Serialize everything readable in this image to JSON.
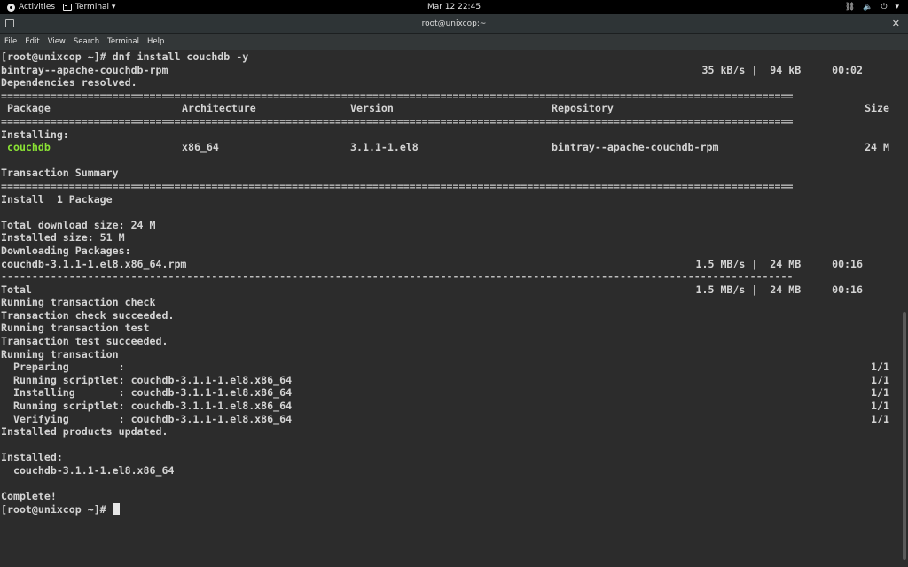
{
  "topbar": {
    "activities": "Activities",
    "app_menu": "Terminal ▾",
    "clock": "Mar 12  22:45",
    "tray": {
      "network": "⛓",
      "volume": "🔈",
      "power": "⏻",
      "menu": "▾"
    }
  },
  "window": {
    "title": "root@unixcop:~",
    "close": "✕"
  },
  "menu": [
    "File",
    "Edit",
    "View",
    "Search",
    "Terminal",
    "Help"
  ],
  "terminal": {
    "lines": [
      {
        "t": "[root@unixcop ~]# dnf install couchdb -y"
      },
      {
        "t": "bintray--apache-couchdb-rpm",
        "r": "35 kB/s |  94 kB     00:02"
      },
      {
        "t": "Dependencies resolved."
      },
      {
        "t": "================================================================================================================================",
        "sep": true
      },
      {
        "cols": [
          " Package",
          "Architecture",
          "Version",
          "Repository"
        ],
        "r": "Size"
      },
      {
        "t": "================================================================================================================================",
        "sep": true
      },
      {
        "t": "Installing:"
      },
      {
        "cols": [
          " couchdb",
          "x86_64",
          "3.1.1-1.el8",
          "bintray--apache-couchdb-rpm"
        ],
        "r": "24 M",
        "green0": true
      },
      {
        "t": ""
      },
      {
        "t": "Transaction Summary"
      },
      {
        "t": "================================================================================================================================",
        "sep": true
      },
      {
        "t": "Install  1 Package"
      },
      {
        "t": ""
      },
      {
        "t": "Total download size: 24 M"
      },
      {
        "t": "Installed size: 51 M"
      },
      {
        "t": "Downloading Packages:"
      },
      {
        "t": "couchdb-3.1.1-1.el8.x86_64.rpm",
        "r": "1.5 MB/s |  24 MB     00:16"
      },
      {
        "t": "--------------------------------------------------------------------------------------------------------------------------------",
        "sep": true
      },
      {
        "t": "Total",
        "r": "1.5 MB/s |  24 MB     00:16"
      },
      {
        "t": "Running transaction check"
      },
      {
        "t": "Transaction check succeeded."
      },
      {
        "t": "Running transaction test"
      },
      {
        "t": "Transaction test succeeded."
      },
      {
        "t": "Running transaction"
      },
      {
        "t": "  Preparing        :",
        "r": "1/1",
        "rr": true
      },
      {
        "t": "  Running scriptlet: couchdb-3.1.1-1.el8.x86_64",
        "r": "1/1",
        "rr": true
      },
      {
        "t": "  Installing       : couchdb-3.1.1-1.el8.x86_64",
        "r": "1/1",
        "rr": true
      },
      {
        "t": "  Running scriptlet: couchdb-3.1.1-1.el8.x86_64",
        "r": "1/1",
        "rr": true
      },
      {
        "t": "  Verifying        : couchdb-3.1.1-1.el8.x86_64",
        "r": "1/1",
        "rr": true
      },
      {
        "t": "Installed products updated."
      },
      {
        "t": ""
      },
      {
        "t": "Installed:"
      },
      {
        "t": "  couchdb-3.1.1-1.el8.x86_64"
      },
      {
        "t": ""
      },
      {
        "t": "Complete!"
      },
      {
        "t": "[root@unixcop ~]# ",
        "cursor": true
      }
    ]
  },
  "colors": {
    "terminal_bg": "#2c2c2c",
    "text": "#d3d3d3",
    "package_green": "#8ae234"
  }
}
